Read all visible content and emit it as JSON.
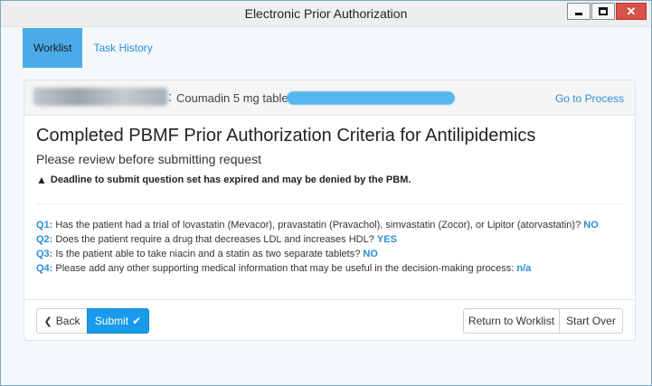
{
  "window": {
    "title": "Electronic Prior Authorization"
  },
  "tabs": [
    {
      "label": "Worklist"
    },
    {
      "label": "Task History"
    }
  ],
  "panel_header": {
    "drug": "Coumadin 5 mg tablet",
    "go_to_process": "Go to Process"
  },
  "content": {
    "heading": "Completed PBMF Prior Authorization Criteria for Antilipidemics",
    "subheading": "Please review before submitting request",
    "warning": "Deadline to submit question set has expired and may be denied by the PBM."
  },
  "questions": [
    {
      "num": "Q1:",
      "text": "Has the patient had a trial of lovastatin (Mevacor), pravastatin (Pravachol), simvastatin (Zocor), or Lipitor (atorvastatin)?",
      "answer": "NO"
    },
    {
      "num": "Q2:",
      "text": "Does the patient require a drug that decreases LDL and increases HDL?",
      "answer": "YES"
    },
    {
      "num": "Q3:",
      "text": "Is the patient able to take niacin and a statin as two separate tablets?",
      "answer": "NO"
    },
    {
      "num": "Q4:",
      "text": "Please add any other supporting medical information that may be useful in the decision-making process:",
      "answer": "n/a"
    }
  ],
  "buttons": {
    "back": "Back",
    "submit": "Submit",
    "return": "Return to Worklist",
    "start_over": "Start Over"
  },
  "colors": {
    "accent": "#2a8fd6",
    "tab_active": "#4aabe8",
    "submit": "#1a9aeb",
    "close": "#d8524a"
  }
}
